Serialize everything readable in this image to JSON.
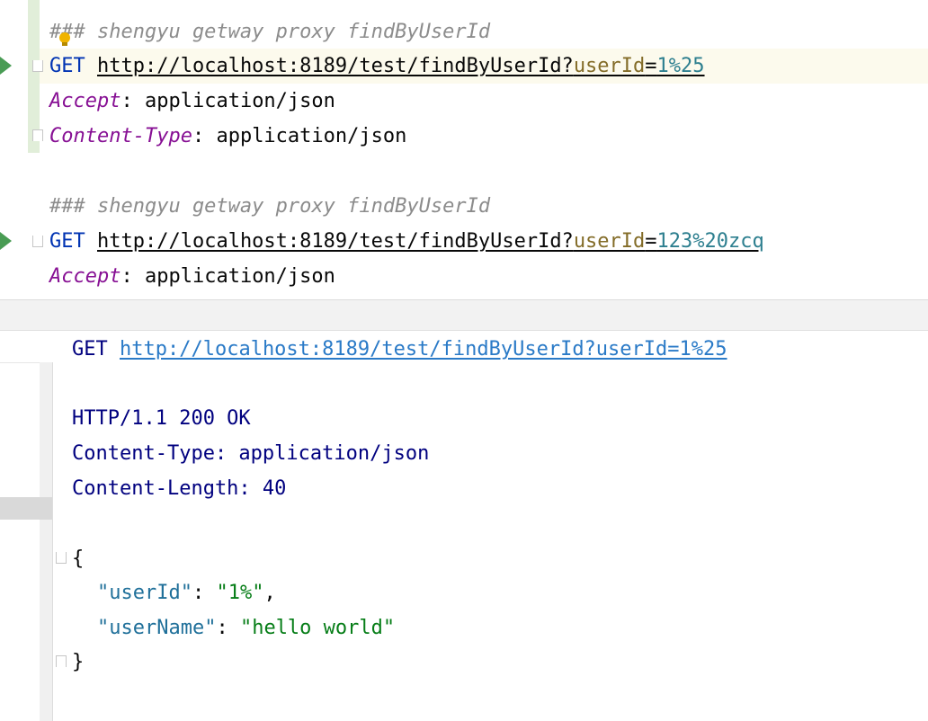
{
  "editor": {
    "requests": [
      {
        "comment": "### shengyu getway proxy findByUserId",
        "method": "GET",
        "url_base": "http://localhost:8189/test/findByUserId?",
        "param_key": "userId",
        "param_eq": "=",
        "param_value": "1%25",
        "headers": [
          {
            "name": "Accept",
            "sep": ": ",
            "value": "application/json"
          },
          {
            "name": "Content-Type",
            "sep": ": ",
            "value": "application/json"
          }
        ]
      },
      {
        "comment": "### shengyu getway proxy findByUserId",
        "method": "GET",
        "url_base": "http://localhost:8189/test/findByUserId?",
        "param_key": "userId",
        "param_eq": "=",
        "param_value": "123%20zcq",
        "headers": [
          {
            "name": "Accept",
            "sep": ": ",
            "value": "application/json"
          }
        ]
      }
    ],
    "icons": {
      "run": "run-icon",
      "bulb": "lightbulb-icon",
      "fold": "fold-icon"
    }
  },
  "response": {
    "method": "GET",
    "url": "http://localhost:8189/test/findByUserId?userId=1%25",
    "status": "HTTP/1.1 200 OK",
    "headers": [
      "Content-Type: application/json",
      "Content-Length: 40"
    ],
    "json_open": "{",
    "json_close": "}",
    "fields": [
      {
        "key": "\"userId\"",
        "sep": ": ",
        "value": "\"1%\"",
        "trail": ","
      },
      {
        "key": "\"userName\"",
        "sep": ": ",
        "value": "\"hello world\"",
        "trail": ""
      }
    ]
  },
  "colors": {
    "keyword": "#0033b3",
    "header_name": "#871094",
    "param_key": "#836c28",
    "param_value": "#2d7f8f",
    "comment": "#8c8c8c",
    "response_text": "#00007f",
    "link": "#2a7ac7",
    "json_key": "#20709a",
    "json_string": "#067d17",
    "run_icon": "#499c54"
  }
}
